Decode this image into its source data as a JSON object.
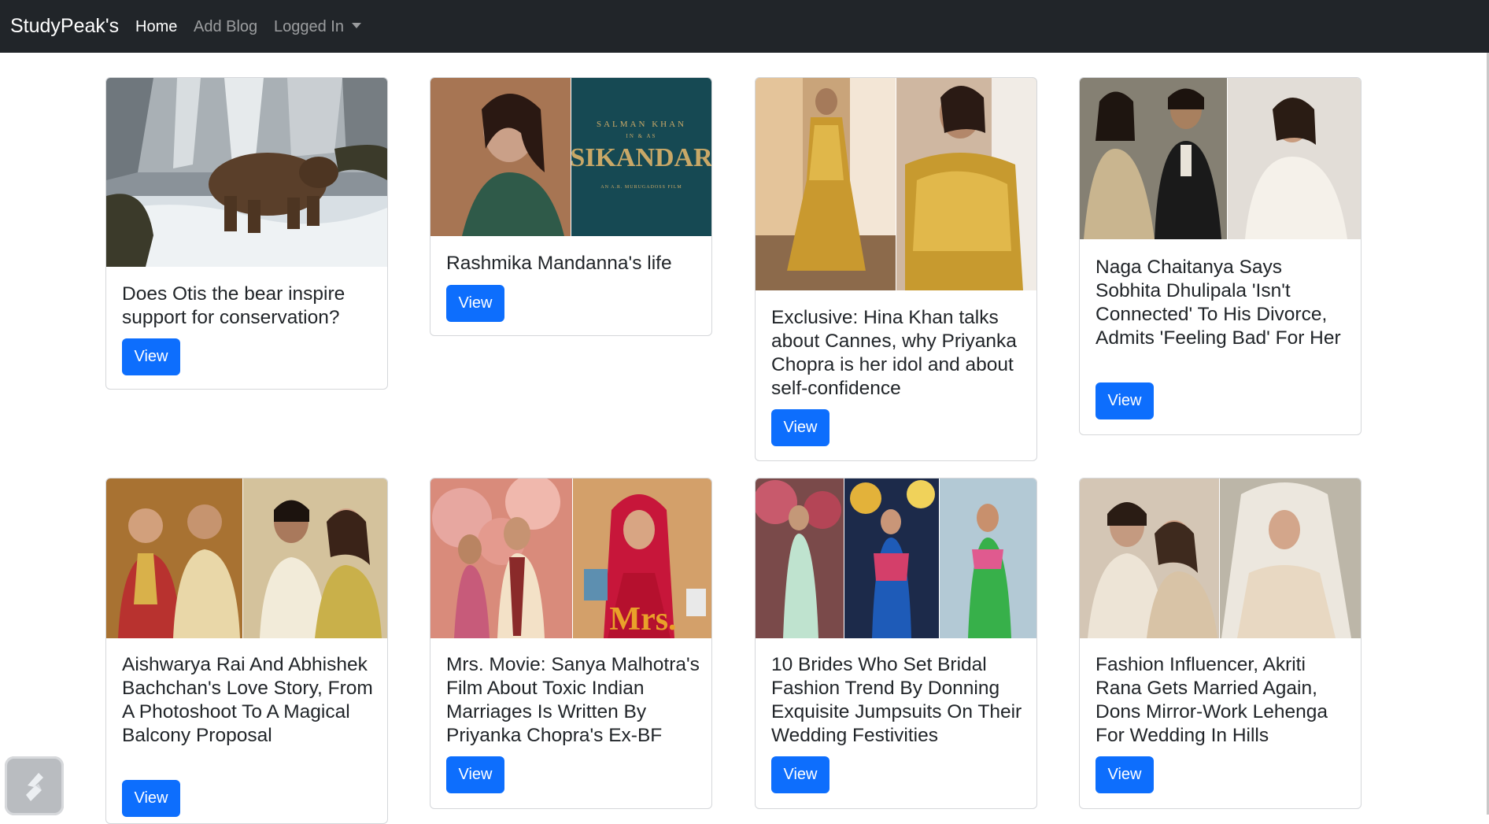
{
  "navbar": {
    "brand": "StudyPeak's",
    "links": {
      "home": "Home",
      "add_blog": "Add Blog",
      "logged_in": "Logged In"
    }
  },
  "cards": [
    {
      "title": "Does Otis the bear inspire support for conservation?",
      "button": "View",
      "image": "bear-in-waterfall-photo"
    },
    {
      "title": "Rashmika Mandanna's life",
      "button": "View",
      "image": "rashmika-sikandar-poster",
      "image_text": {
        "top": "SALMAN KHAN",
        "middle": "IN & AS",
        "main": "SIKANDAR",
        "sub": "AN A.R. MURUGADOSS FILM"
      }
    },
    {
      "title": "Exclusive: Hina Khan talks about Cannes, why Priyanka Chopra is her idol and about self-confidence",
      "button": "View",
      "image": "hina-khan-gold-gown-photo"
    },
    {
      "title": "Naga Chaitanya Says Sobhita Dhulipala 'Isn't Connected' To His Divorce, Admits 'Feeling Bad' For Her",
      "button": "View",
      "image": "naga-chaitanya-sobhita-samantha-photo"
    },
    {
      "title": "Aishwarya Rai And Abhishek Bachchan's Love Story, From A Photoshoot To A Magical Balcony Proposal",
      "button": "View",
      "image": "aishwarya-abhishek-wedding-photo"
    },
    {
      "title": "Mrs. Movie: Sanya Malhotra's Film About Toxic Indian Marriages Is Written By Priyanka Chopra's Ex-BF",
      "button": "View",
      "image": "mrs-movie-poster",
      "image_text": {
        "main": "Mrs."
      }
    },
    {
      "title": "10 Brides Who Set Bridal Fashion Trend By Donning Exquisite Jumpsuits On Their Wedding Festivities",
      "button": "View",
      "image": "brides-jumpsuits-photo"
    },
    {
      "title": "Fashion Influencer, Akriti Rana Gets Married Again, Dons Mirror-Work Lehenga For Wedding In Hills",
      "button": "View",
      "image": "akriti-rana-wedding-photo"
    }
  ],
  "floating_widget": {
    "icon": "lightning-logo-icon"
  }
}
